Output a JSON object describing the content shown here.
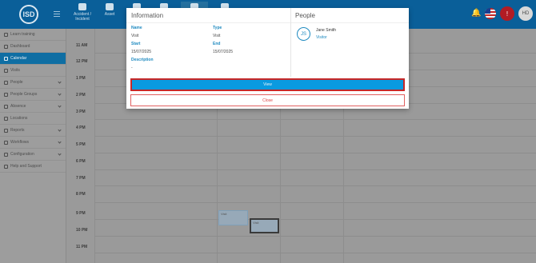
{
  "header": {
    "logo_text": "ISD",
    "nav_items": [
      {
        "label": "Accident / Incident",
        "icon": "briefcase-icon"
      },
      {
        "label": "Asset",
        "icon": "grid-icon"
      },
      {
        "label": "",
        "icon": "gear-icon"
      },
      {
        "label": "",
        "icon": "document-icon"
      },
      {
        "label": "",
        "icon": "person-icon"
      },
      {
        "label": "",
        "icon": "camera-icon"
      }
    ],
    "user_initials": "HD",
    "notifications_icon": "bell-icon",
    "language_icon": "us-flag-icon",
    "alert_icon": "alert-icon"
  },
  "sidebar": {
    "items": [
      {
        "label": "Learn training",
        "icon": "graduation-icon",
        "active": false,
        "expandable": false
      },
      {
        "label": "Dashboard",
        "icon": "dashboard-icon",
        "active": false,
        "expandable": false
      },
      {
        "label": "Calendar",
        "icon": "calendar-icon",
        "active": true,
        "expandable": false
      },
      {
        "label": "Visits",
        "icon": "visits-icon",
        "active": false,
        "expandable": false
      },
      {
        "label": "People",
        "icon": "people-icon",
        "active": false,
        "expandable": true
      },
      {
        "label": "People Groups",
        "icon": "group-icon",
        "active": false,
        "expandable": true
      },
      {
        "label": "Absence",
        "icon": "absence-icon",
        "active": false,
        "expandable": true
      },
      {
        "label": "Locations",
        "icon": "location-icon",
        "active": false,
        "expandable": false
      },
      {
        "label": "Reports",
        "icon": "reports-icon",
        "active": false,
        "expandable": true
      },
      {
        "label": "Workflows",
        "icon": "workflow-icon",
        "active": false,
        "expandable": true
      },
      {
        "label": "Configuration",
        "icon": "configuration-icon",
        "active": false,
        "expandable": true
      },
      {
        "label": "Help and Support",
        "icon": "help-icon",
        "active": false,
        "expandable": false
      }
    ]
  },
  "calendar": {
    "hours": [
      "11 AM",
      "12 PM",
      "1 PM",
      "2 PM",
      "3 PM",
      "4 PM",
      "5 PM",
      "6 PM",
      "7 PM",
      "8 PM",
      "9 PM",
      "10 PM",
      "11 PM"
    ],
    "events": [
      {
        "label": "Visit",
        "selected": false
      },
      {
        "label": "Visit",
        "selected": true
      }
    ]
  },
  "modal": {
    "info_title": "Information",
    "people_title": "People",
    "name_label": "Name",
    "name_value": "Visit",
    "type_label": "Type",
    "type_value": "Visit",
    "start_label": "Start",
    "start_value": "15/07/2025",
    "end_label": "End",
    "end_value": "15/07/2025",
    "description_label": "Description",
    "description_value": "-",
    "person_initials": "JS",
    "person_name": "Jane Smith",
    "person_role": "Visitor",
    "view_button": "View",
    "close_button": "Close"
  },
  "colors": {
    "primary": "#0a5f99",
    "accent": "#0a9ae0",
    "active_sidebar": "#0f6ea3",
    "danger": "#c62828"
  }
}
